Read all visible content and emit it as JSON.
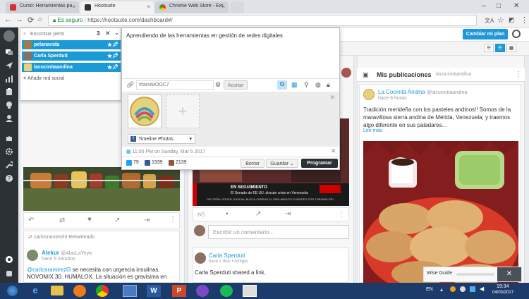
{
  "browser": {
    "tabs": [
      {
        "label": "Curso: Herramientas pa"
      },
      {
        "label": "Hootsuite"
      },
      {
        "label": "Chrome Web Store - Ext"
      }
    ],
    "address": {
      "secure_label": "Es seguro",
      "url": "https://hootsuite.com/dashboard#/"
    }
  },
  "header": {
    "plan_button": "Cambiar mi plan"
  },
  "picker": {
    "search_placeholder": "Encontrar perfil",
    "count": "3",
    "profiles": [
      {
        "name": "pelanavida"
      },
      {
        "name": "Carla Sperduti"
      },
      {
        "name": "lacocinitaandina"
      }
    ],
    "add_social": "Añadir red social"
  },
  "composer": {
    "message": "Aprendiendo de las herramientas en gestión de redes digitales",
    "link_placeholder": "#tarsiMOOC7",
    "shorten_button": "Acortar",
    "media_dropdown": "Timeline Photos",
    "schedule": "11:00 PM on Sunday, Mar 5 2017",
    "stats": {
      "twitter": "79",
      "facebook": "1939",
      "other": "2139"
    },
    "delete_button": "Borrar",
    "save_button": "Guardar",
    "schedule_button": "Programar"
  },
  "stream_mid": {
    "news_label": "EN SEGUIMIENTO",
    "news_text": "El Senado de EE.UU. discute crisis en Venezuela",
    "news_ticker": "DIP. PEÑA: PODER JUDICIAL BUSCA CERRAR EL PARLAMENTO EUROPEO POR TURISMO SEXUAL",
    "comment_placeholder": "Escribir un comentario...",
    "post_author": "Carla Sperduti",
    "post_meta": "hace 2 días",
    "post_audience": "Amigos",
    "post_text": "Carla Sperduti shared a link."
  },
  "stream_left": {
    "retweet_by": "carlosramirezl3",
    "retweet_suffix": "Retwitteado",
    "author": "Alekur",
    "handle": "@AlasLaYeya",
    "time": "hace 5 minutos",
    "text_mention": "@carlosramirezl3",
    "text": " se necesita con urgencia insulinas. NOVOMIX 30. HUMALOX. La situación es gravisima en"
  },
  "stream_right": {
    "title": "Mis publicaciones",
    "account": "lacocinitaandina",
    "author": "La Cocinita Andina",
    "handle": "@lacocinitaandina",
    "time": "hace 6 horas",
    "text": "Tradición merideña con los pasteles andinos!! Somos de la maravillosa sierra andina de Mérida, Venezuela; y traemos algo diferente en sus paladares...",
    "more": "Lee más"
  },
  "wise_guide": {
    "label": "Wise Guide"
  },
  "taskbar": {
    "lang": "EN",
    "time": "19:34",
    "date": "04/03/2017"
  },
  "colors": {
    "accent": "#1c9ad6",
    "rail": "#2b3135",
    "twitter": "#1da1f2",
    "facebook": "#3b5998"
  }
}
